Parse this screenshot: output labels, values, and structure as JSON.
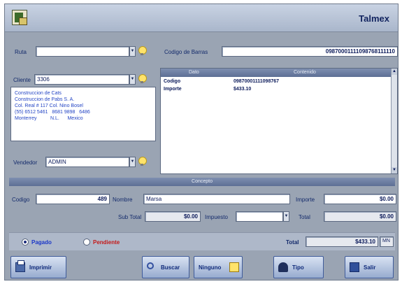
{
  "window": {
    "title": "Talmex"
  },
  "left": {
    "ruta_label": "Ruta",
    "ruta_value": "",
    "cliente_label": "Cliente",
    "cliente_value": "3306",
    "address_lines": [
      "Construccion de Cats",
      "Construccion de Pabs S. A.",
      "Col. Real # 117 Col. Nino Bosel",
      "(55) 6512 5461   8681 9898   6486",
      "Monterrey          N.L.      Mexico"
    ],
    "vendedor_label": "Vendedor",
    "vendedor_value": "ADMIN"
  },
  "right": {
    "barcode_label": "Codigo de Barras",
    "barcode_value": "09870001111098768111110",
    "grid": {
      "columns": [
        "Dato",
        "Contenido"
      ],
      "rows": [
        {
          "dato": "Codigo",
          "contenido": "09870001111098767"
        },
        {
          "dato": "Importe",
          "contenido": "$433.10"
        }
      ]
    }
  },
  "section": {
    "title": "Concepto"
  },
  "concept": {
    "codigo_label": "Codigo",
    "codigo_value": "489",
    "nombre_label": "Nombre",
    "nombre_value": "Marsa",
    "importe_label": "Importe",
    "importe_value": "$0.00",
    "subtotal_label": "Sub Total",
    "subtotal_value": "$0.00",
    "impuesto_label": "Impuesto",
    "impuesto_value": "",
    "total_label": "Total",
    "total_value": "$0.00"
  },
  "payment": {
    "option_1": "Pagado",
    "option_2": "Pendiente",
    "total_label": "Total",
    "total_value": "$433.10",
    "currency": "MN"
  },
  "buttons": {
    "imprimir": "Imprimir",
    "buscar": "Buscar",
    "ninguno": "Ninguno",
    "ticket": "Tipo",
    "salir": "Salir"
  }
}
